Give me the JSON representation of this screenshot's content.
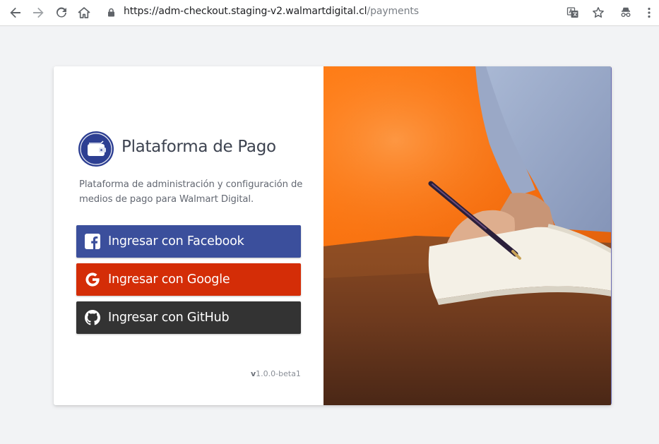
{
  "browser": {
    "url_host": "https://adm-checkout.staging-v2.walmartdigital.cl",
    "url_path": "/payments"
  },
  "app": {
    "title": "Plataforma de Pago",
    "description": "Plataforma de administración y configuración de medios de pago para Walmart Digital."
  },
  "buttons": {
    "facebook": "Ingresar con Facebook",
    "google": "Ingresar con Google",
    "github": "Ingresar con GitHub"
  },
  "version": {
    "prefix": "v",
    "number": "1.0.0-beta1"
  },
  "colors": {
    "facebook": "#3b4f9c",
    "google": "#d42d07",
    "github": "#333333",
    "logo": "#2d3f92",
    "photo_background": "#ff7a12"
  }
}
